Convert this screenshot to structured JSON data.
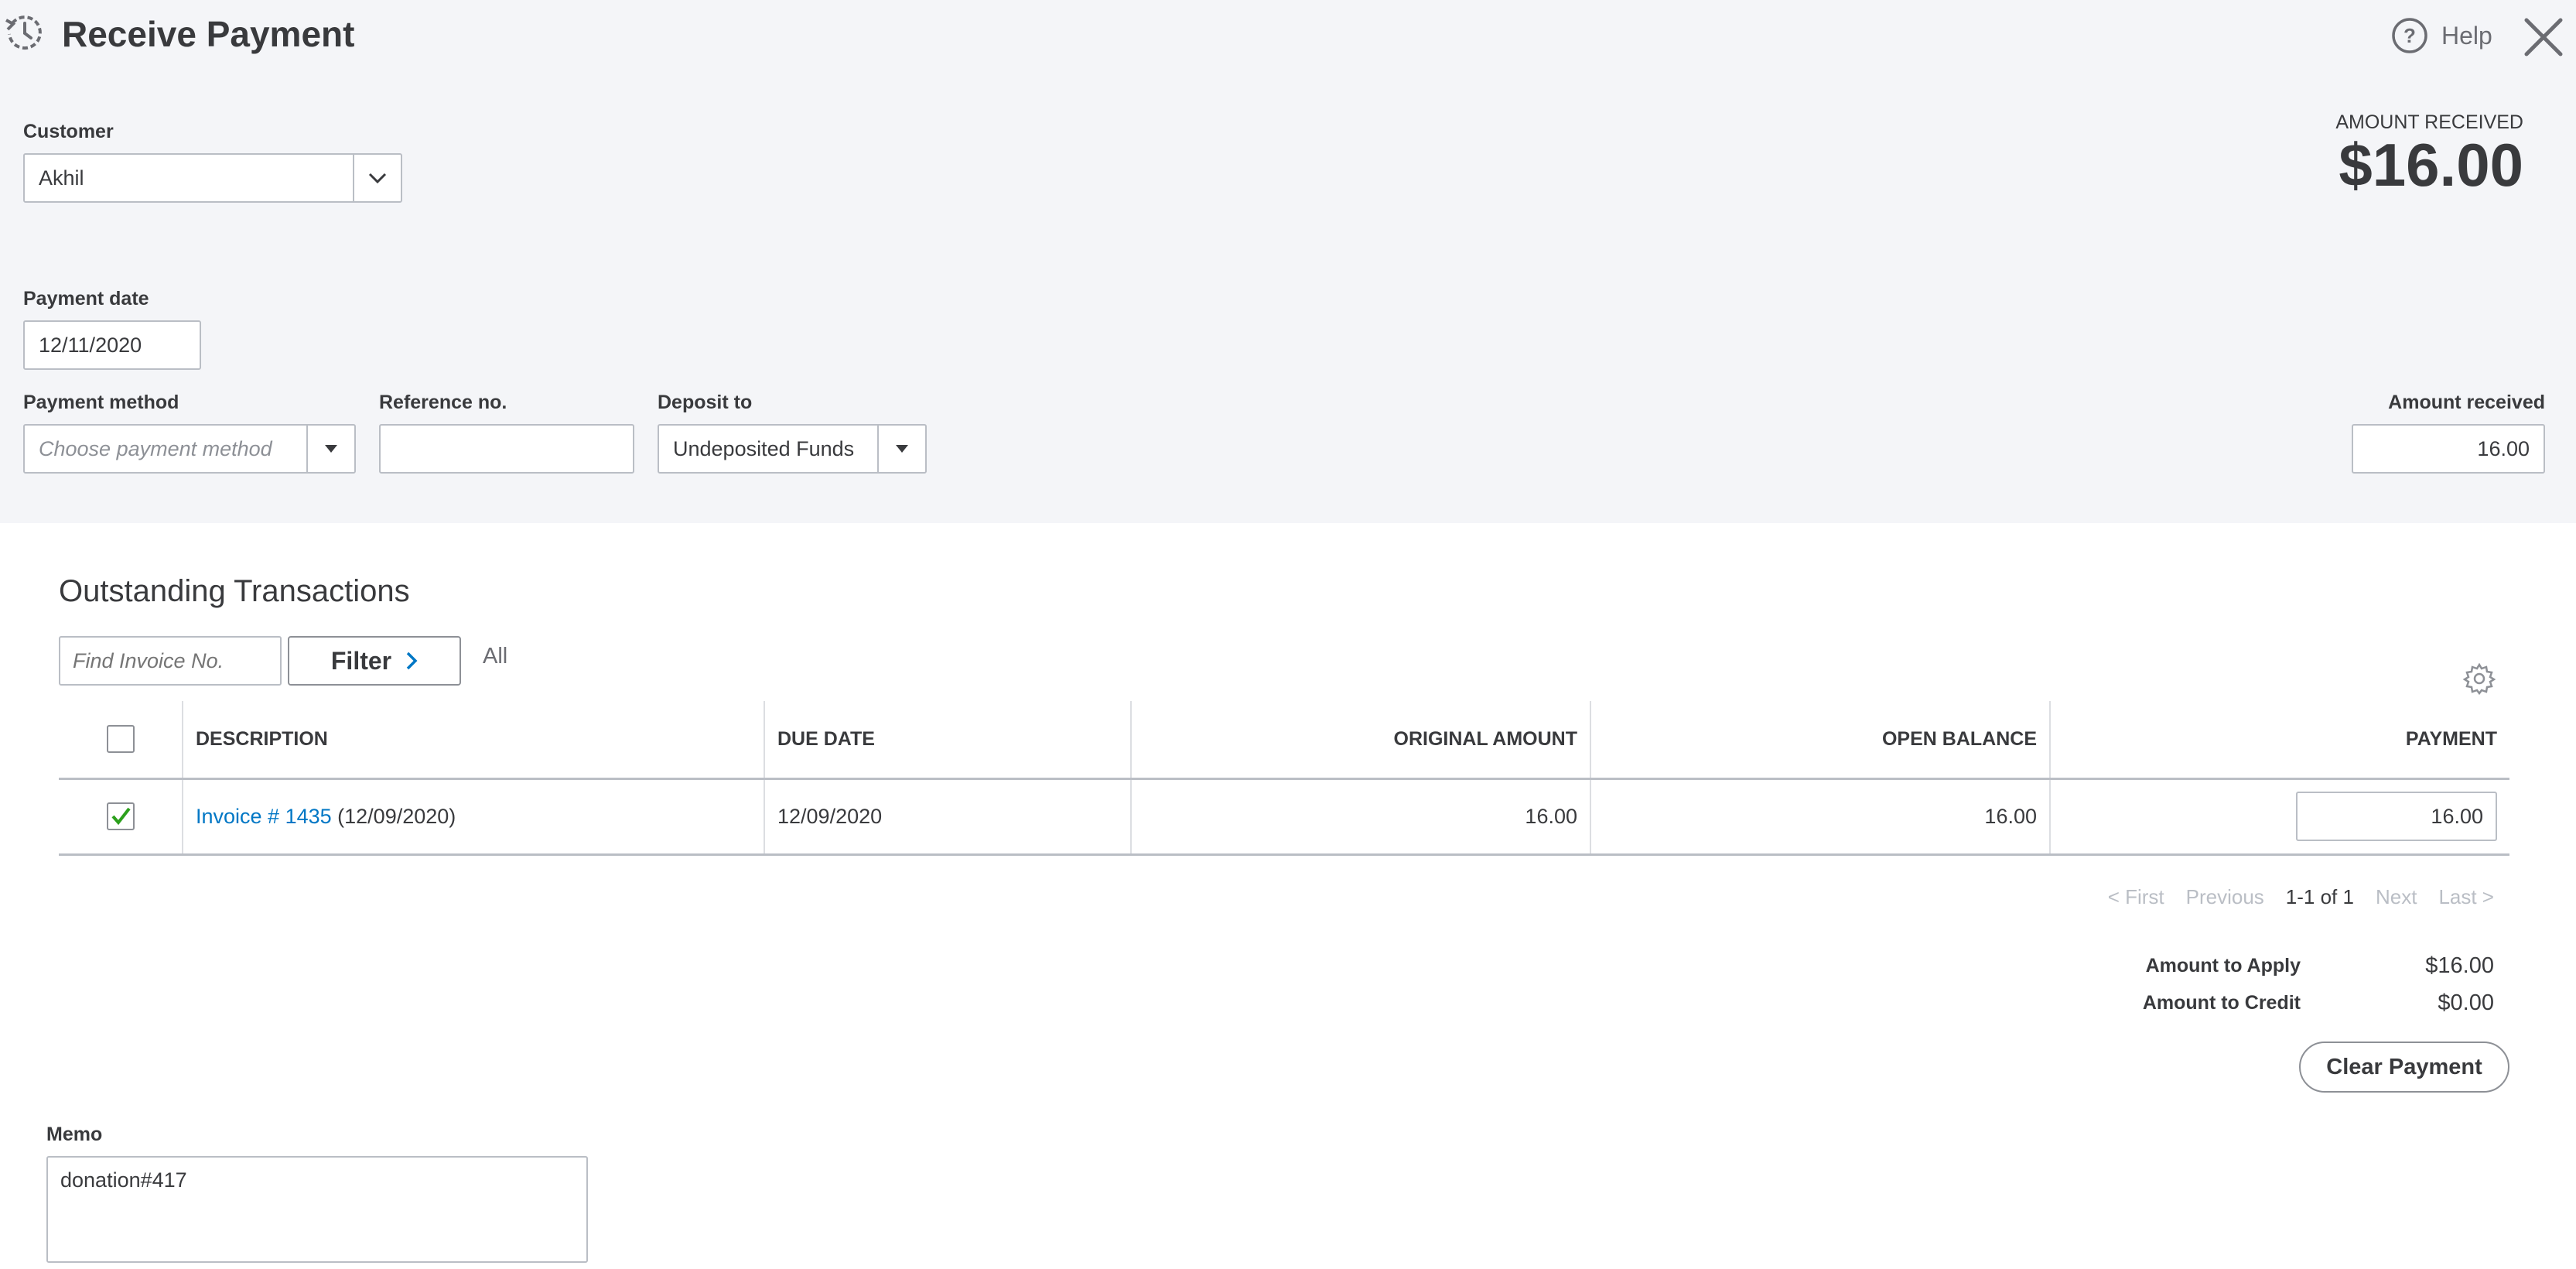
{
  "header": {
    "title": "Receive Payment",
    "help_label": "Help",
    "icons": [
      "history-icon",
      "help-icon",
      "close-icon"
    ]
  },
  "customer": {
    "label": "Customer",
    "value": "Akhil"
  },
  "amount_summary": {
    "label": "AMOUNT RECEIVED",
    "value": "$16.00"
  },
  "payment_date": {
    "label": "Payment date",
    "value": "12/11/2020"
  },
  "payment_method": {
    "label": "Payment method",
    "placeholder": "Choose payment method"
  },
  "reference_no": {
    "label": "Reference no.",
    "value": ""
  },
  "deposit_to": {
    "label": "Deposit to",
    "value": "Undeposited Funds"
  },
  "amount_received": {
    "label": "Amount received",
    "value": "16.00"
  },
  "outstanding": {
    "title": "Outstanding Transactions",
    "find_placeholder": "Find Invoice No.",
    "filter_label": "Filter",
    "all_label": "All",
    "columns": [
      "DESCRIPTION",
      "DUE DATE",
      "ORIGINAL AMOUNT",
      "OPEN BALANCE",
      "PAYMENT"
    ],
    "rows": [
      {
        "checked": true,
        "invoice_link": "Invoice # 1435",
        "invoice_date": "(12/09/2020)",
        "due_date": "12/09/2020",
        "original_amount": "16.00",
        "open_balance": "16.00",
        "payment": "16.00"
      }
    ],
    "pagination": {
      "first": "< First",
      "previous": "Previous",
      "range": "1-1 of 1",
      "next": "Next",
      "last": "Last >"
    }
  },
  "totals": {
    "apply_label": "Amount to Apply",
    "apply_value": "$16.00",
    "credit_label": "Amount to Credit",
    "credit_value": "$0.00",
    "clear_label": "Clear Payment"
  },
  "memo": {
    "label": "Memo",
    "value": "donation#417"
  },
  "colors": {
    "accent": "#0077c5",
    "check_green": "#2ca01c",
    "panel_bg": "#f4f5f8",
    "text": "#393a3d"
  }
}
